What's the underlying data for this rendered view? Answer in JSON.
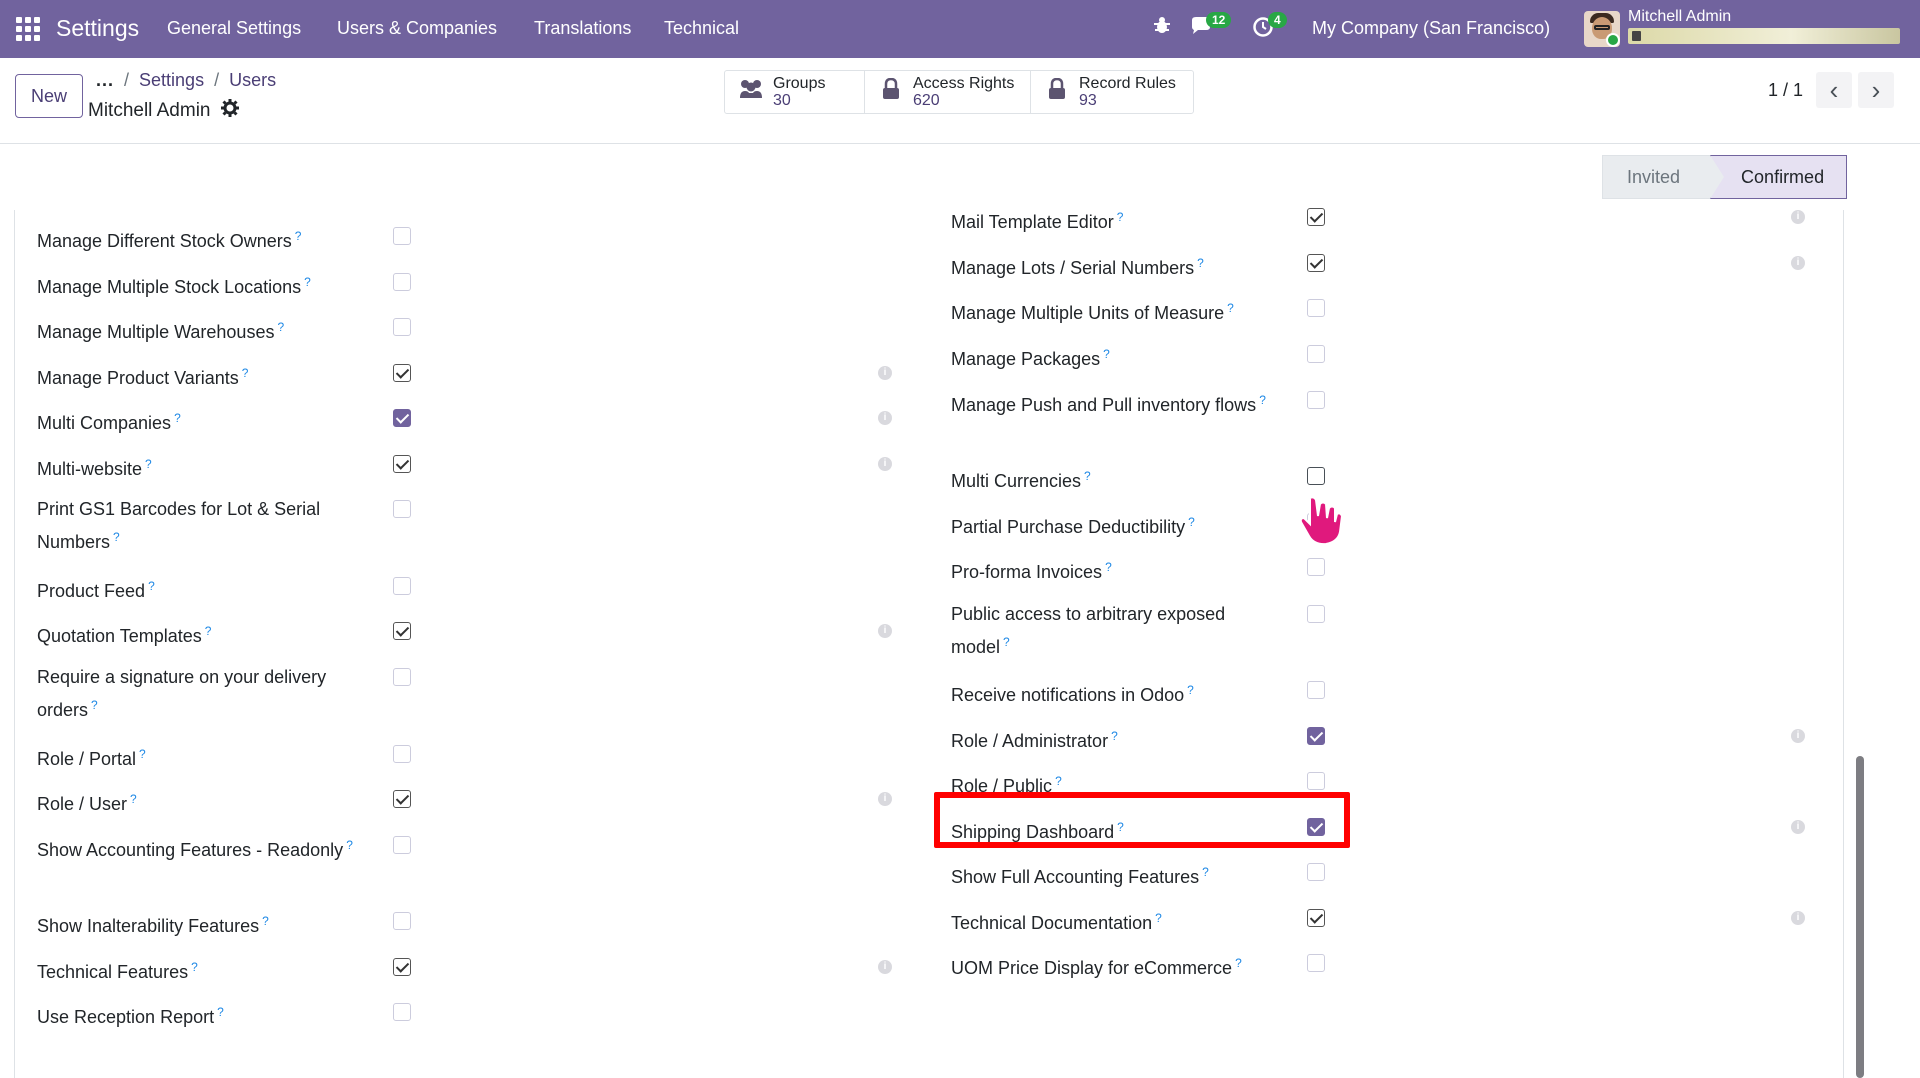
{
  "navbar": {
    "app_title": "Settings",
    "menu": [
      "General Settings",
      "Users & Companies",
      "Translations",
      "Technical"
    ],
    "messages_badge": "12",
    "activity_badge": "4",
    "company": "My Company (San Francisco)",
    "user_name": "Mitchell Admin"
  },
  "control": {
    "new_label": "New",
    "breadcrumb_dots": "...",
    "breadcrumb": [
      "Settings",
      "Users"
    ],
    "record_title": "Mitchell Admin",
    "smart_buttons": [
      {
        "label": "Groups",
        "value": "30",
        "icon": "users-icon"
      },
      {
        "label": "Access Rights",
        "value": "620",
        "icon": "lock-icon"
      },
      {
        "label": "Record Rules",
        "value": "93",
        "icon": "lock-icon"
      }
    ],
    "pager": "1 / 1"
  },
  "status": {
    "stages": [
      "Invited",
      "Confirmed"
    ],
    "active": "Confirmed"
  },
  "left_fields": [
    {
      "label": "Manage Different Stock Owners",
      "state": "unchecked"
    },
    {
      "label": "Manage Multiple Stock Locations",
      "state": "unchecked"
    },
    {
      "label": "Manage Multiple Warehouses",
      "state": "unchecked"
    },
    {
      "label": "Manage Product Variants",
      "state": "checked"
    },
    {
      "label": "Multi Companies",
      "state": "checked-filled"
    },
    {
      "label": "Multi-website",
      "state": "checked"
    },
    {
      "label": "Print GS1 Barcodes for Lot & Serial Numbers",
      "state": "unchecked"
    },
    {
      "label": "Product Feed",
      "state": "unchecked"
    },
    {
      "label": "Quotation Templates",
      "state": "checked"
    },
    {
      "label": "Require a signature on your delivery orders",
      "state": "unchecked"
    },
    {
      "label": "Role / Portal",
      "state": "unchecked"
    },
    {
      "label": "Role / User",
      "state": "checked"
    },
    {
      "label": "Show Accounting Features - Readonly",
      "state": "unchecked"
    },
    {
      "label": "Show Inalterability Features",
      "state": "unchecked"
    },
    {
      "label": "Technical Features",
      "state": "checked"
    },
    {
      "label": "Use Reception Report",
      "state": "unchecked"
    }
  ],
  "right_fields": [
    {
      "label": "Mail Template Editor",
      "state": "checked"
    },
    {
      "label": "Manage Lots / Serial Numbers",
      "state": "checked"
    },
    {
      "label": "Manage Multiple Units of Measure",
      "state": "unchecked"
    },
    {
      "label": "Manage Packages",
      "state": "unchecked"
    },
    {
      "label": "Manage Push and Pull inventory flows",
      "state": "unchecked"
    },
    {
      "label": "Multi Currencies",
      "state": "hover"
    },
    {
      "label": "Partial Purchase Deductibility",
      "state": "unchecked"
    },
    {
      "label": "Pro-forma Invoices",
      "state": "unchecked"
    },
    {
      "label": "Public access to arbitrary exposed model",
      "state": "unchecked"
    },
    {
      "label": "Receive notifications in Odoo",
      "state": "unchecked"
    },
    {
      "label": "Role / Administrator",
      "state": "checked-filled"
    },
    {
      "label": "Role / Public",
      "state": "unchecked"
    },
    {
      "label": "Shipping Dashboard",
      "state": "checked-filled"
    },
    {
      "label": "Show Full Accounting Features",
      "state": "unchecked"
    },
    {
      "label": "Technical Documentation",
      "state": "checked"
    },
    {
      "label": "UOM Price Display for eCommerce",
      "state": "unchecked"
    }
  ],
  "help_marker": "?",
  "info_marker": "i",
  "colors": {
    "navbar": "#71639e",
    "accent": "#71639e",
    "highlight": "#ff0000"
  }
}
